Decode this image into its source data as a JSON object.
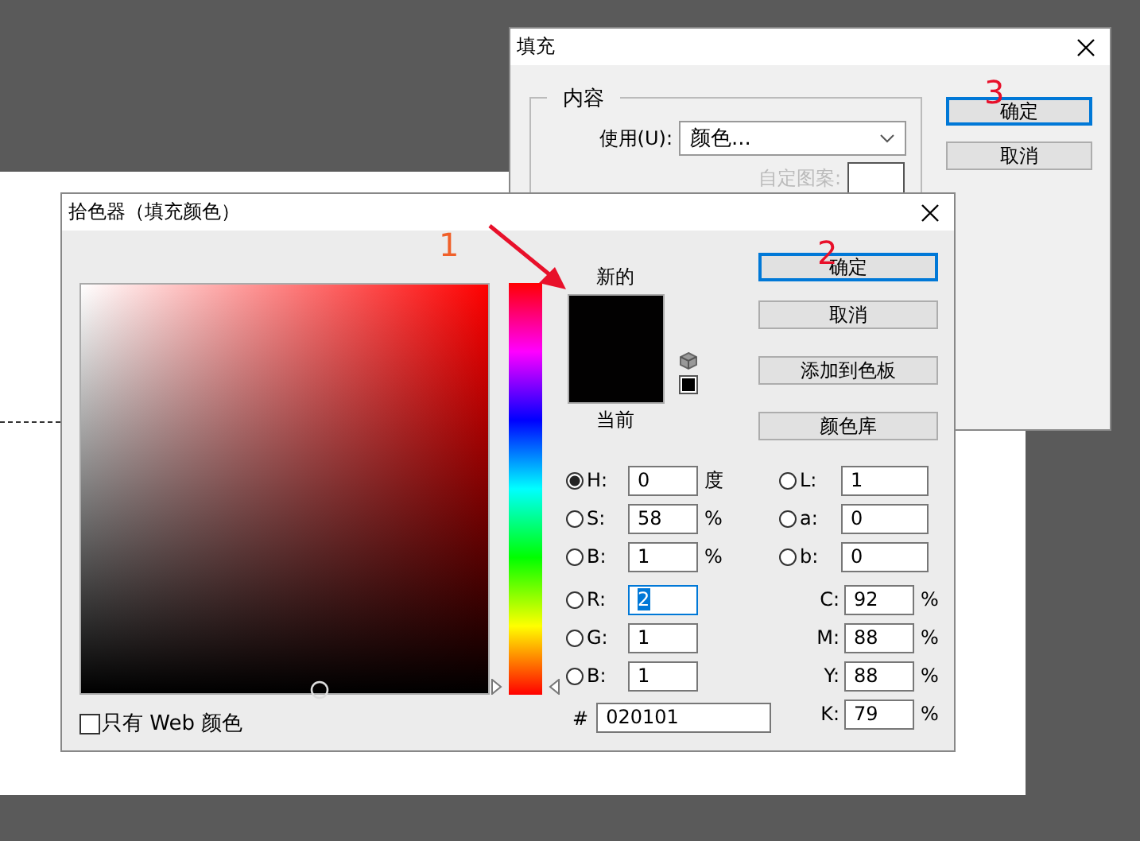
{
  "fill_dialog": {
    "title": "填充",
    "group_title": "内容",
    "use_label": "使用(U):",
    "use_value": "颜色...",
    "pattern_label": "自定图案:",
    "pattern_disabled": true,
    "buttons": [
      {
        "label": "确定",
        "focused": true
      },
      {
        "label": "取消",
        "focused": false
      }
    ]
  },
  "color_picker": {
    "title": "拾色器（填充颜色）",
    "new_label": "新的",
    "current_label": "当前",
    "buttons": [
      {
        "label": "确定",
        "focused": true
      },
      {
        "label": "取消",
        "focused": false
      },
      {
        "label": "添加到色板",
        "focused": false
      },
      {
        "label": "颜色库",
        "focused": false
      }
    ],
    "hsb_rgb": [
      {
        "label": "H:",
        "value": "0",
        "unit": "度",
        "selected": true,
        "focused": false
      },
      {
        "label": "S:",
        "value": "58",
        "unit": "%",
        "selected": false,
        "focused": false
      },
      {
        "label": "B:",
        "value": "1",
        "unit": "%",
        "selected": false,
        "focused": false
      },
      {
        "label": "R:",
        "value": "2",
        "selected": false,
        "focused": true
      },
      {
        "label": "G:",
        "value": "1",
        "selected": false,
        "focused": false
      },
      {
        "label": "B:",
        "value": "1",
        "selected": false,
        "focused": false
      }
    ],
    "lab": [
      {
        "label": "L:",
        "value": "1",
        "selected": false
      },
      {
        "label": "a:",
        "value": "0",
        "selected": false
      },
      {
        "label": "b:",
        "value": "0",
        "selected": false
      }
    ],
    "cmyk": [
      {
        "label": "C:",
        "value": "92",
        "unit": "%"
      },
      {
        "label": "M:",
        "value": "88",
        "unit": "%"
      },
      {
        "label": "Y:",
        "value": "88",
        "unit": "%"
      },
      {
        "label": "K:",
        "value": "79",
        "unit": "%"
      }
    ],
    "hue_slider": {
      "level": 0
    },
    "hex_label": "#",
    "hex": "020101",
    "web_only": {
      "label": "只有 Web 颜色",
      "checked": false
    }
  },
  "annotations": [
    {
      "text": "1"
    },
    {
      "text": "2"
    },
    {
      "text": "3"
    }
  ]
}
